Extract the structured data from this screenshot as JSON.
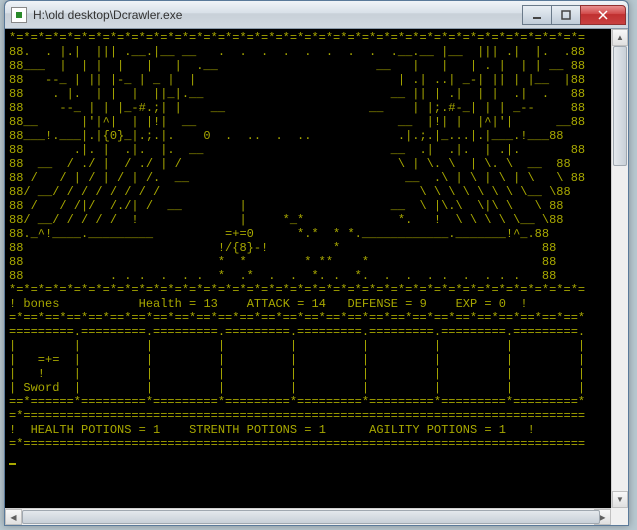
{
  "window": {
    "title": "H:\\old desktop\\Dcrawler.exe"
  },
  "colors": {
    "console_fg": "#a8a800",
    "console_bg": "#000000"
  },
  "dungeon": {
    "lines": [
      "*=*=*=*=*=*=*=*=*=*=*=*=*=*=*=*=*=*=*=*=*=*=*=*=*=*=*=*=*=*=*=*=*=*=*=*=*=*=*=*=",
      "88.  . |.|  ||| .__.|__ __   .  .  .  .  .  .  .  .  .__.__ |__  ||| .|  |.  .88",
      "88___  |  | |  |   |   |  .__                      __   |   |   | . |  | | __ 88",
      "88   --_ | || |-_ | _ |  |                            | .| ..| _-| || | |__  |88",
      "88    . |.  | |  |  ||_|.__                          __ || | .|  | |  .|  .   88",
      "88     --_ | | |_-#.;| |    __                    __    | |;.#-_| | | _--     88",
      "88__      |'|^|  | |!|  __                            __  |!| |  |^|'|      __88",
      "88___!.___|.|{0}_|.;.|.    0  .  ..  .  ..            .|.;.|_...|.|___.!___88",
      "88       .|. |  .|.  |.  __                          __  .|  .|.  | .|.       88",
      "88  __  / ./ |  / ./ | /                              \\ | \\. \\  | \\. \\  __  88",
      "88 /   / | / | / | /.  __                              __  .\\ | \\ | \\ | \\   \\ 88",
      "88/ __/ / / / / / / /                                    \\ \\ \\ \\ \\ \\ \\ \\__ \\88",
      "88 /   / /|/  /./| /  __        |                    __  \\ |\\.\\  \\|\\ \\   \\ 88",
      "88/ __/ / / / /  !              |     *_*             *.   !  \\ \\ \\ \\ \\__ \\88",
      "88._^!____._________          =+=0      *.*  * *.____________._______!^_.88",
      "88                           !/{8}-!         *                            88",
      "88                           *  *        * **    *                        88",
      "88            . . .  .  . .  *  .*  .  .  *. .  *.  .  .  . .  .  . . .   88",
      "*=*=*=*=*=*=*=*=*=*=*=*=*=*=*=*=*=*=*=*=*=*=*=*=*=*=*=*=*=*=*=*=*=*=*=*=*=*=*=*="
    ]
  },
  "stats": {
    "name_label": "bones",
    "health_label": "Health",
    "health": 13,
    "attack_label": "ATTACK",
    "attack": 14,
    "defense_label": "DEFENSE",
    "defense": 9,
    "exp_label": "EXP",
    "exp": 0,
    "border": "=*==*==*==*==*==*==*==*==*==*==*==*==*==*==*==*==*==*==*==*==*==*==*==*==*==*==*"
  },
  "inventory": {
    "top": "=========.=========.=========.=========.=========.=========.=========.=========.",
    "row_blank": "|        |         |         |         |         |         |         |         |",
    "slot1_icon": "|   =+=  |         |         |         |         |         |         |         |",
    "slot1_handle": "|   !    |         |         |         |         |         |         |         |",
    "slot1_name": "Sword",
    "bottom": "==*======*=========*=========*=========*=========*=========*=========*=========*"
  },
  "potions": {
    "border": "=*==============================================================================",
    "health_label": "HEALTH POTIONS",
    "health": 1,
    "strength_label": "STRENTH POTIONS",
    "strength": 1,
    "agility_label": "AGILITY POTIONS",
    "agility": 1,
    "bottom": "=*=============================================================================="
  }
}
